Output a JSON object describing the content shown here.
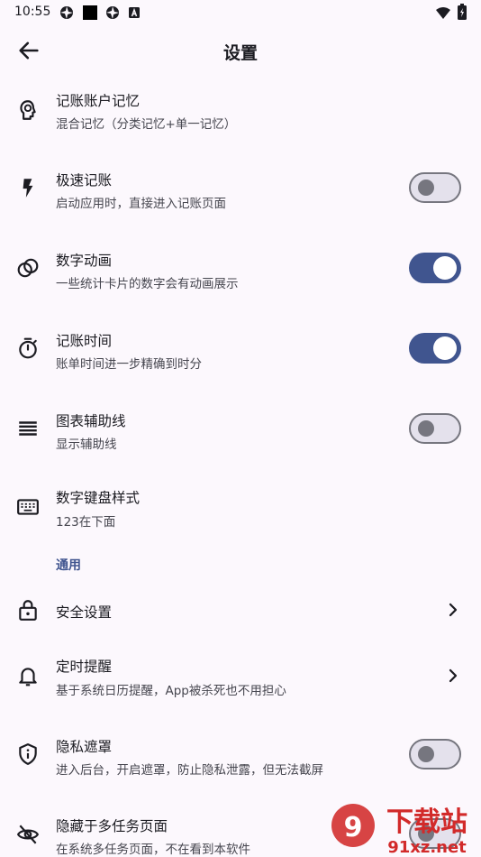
{
  "status_bar": {
    "time": "10:55"
  },
  "header": {
    "title": "设置"
  },
  "items": [
    {
      "title": "记账账户记忆",
      "subtitle": "混合记忆（分类记忆+单一记忆）"
    },
    {
      "title": "极速记账",
      "subtitle": "启动应用时，直接进入记账页面",
      "toggle": "off"
    },
    {
      "title": "数字动画",
      "subtitle": "一些统计卡片的数字会有动画展示",
      "toggle": "on"
    },
    {
      "title": "记账时间",
      "subtitle": "账单时间进一步精确到时分",
      "toggle": "on"
    },
    {
      "title": "图表辅助线",
      "subtitle": "显示辅助线",
      "toggle": "off"
    },
    {
      "title": "数字键盘样式",
      "subtitle": "123在下面"
    }
  ],
  "section_general": "通用",
  "general_items": [
    {
      "title": "安全设置"
    },
    {
      "title": "定时提醒",
      "subtitle": "基于系统日历提醒，App被杀死也不用担心"
    },
    {
      "title": "隐私遮罩",
      "subtitle": "进入后台，开启遮罩，防止隐私泄露，但无法截屏",
      "toggle": "off"
    },
    {
      "title": "隐藏于多任务页面",
      "subtitle": "在系统多任务页面，不在看到本软件"
    }
  ],
  "watermark": {
    "brand": "下载站",
    "domain": "91xz.net"
  },
  "colors": {
    "accent": "#40558f",
    "background": "#fcf8fd",
    "switch_off": "#76767f"
  }
}
